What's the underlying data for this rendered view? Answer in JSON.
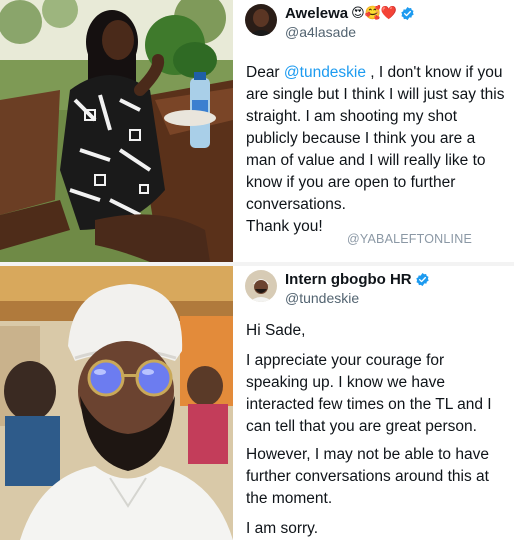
{
  "post_one": {
    "author_name": "Awelewa",
    "author_emojis": "😍🥰❤️",
    "author_handle": "@a4lasade",
    "greeting_prefix": "Dear ",
    "mention": "@tundeskie",
    "line1_rest": " , I don't know if",
    "body": "you are single but I think I will just say this straight. I am shooting my shot publicly because I think you are a man of value and I will really like to know if you are open to further conversations.",
    "signoff": "Thank you!"
  },
  "post_two": {
    "author_name": "Intern gbogbo HR",
    "author_handle": "@tundeskie",
    "greeting": "Hi Sade,",
    "paragraph1": "I appreciate your courage for speaking up. I know we have interacted few times on the TL and I can tell that you are great person.",
    "paragraph2": "However, I may not be able to have further conversations around this at the moment.",
    "paragraph3": "I am sorry."
  },
  "watermark": "@YABALEFTONLINE",
  "colors": {
    "mention": "#1d9bf0",
    "verified_badge": "#1d9bf0",
    "secondary_text": "#536471"
  },
  "icons": {
    "verified": "verified-badge-icon"
  }
}
